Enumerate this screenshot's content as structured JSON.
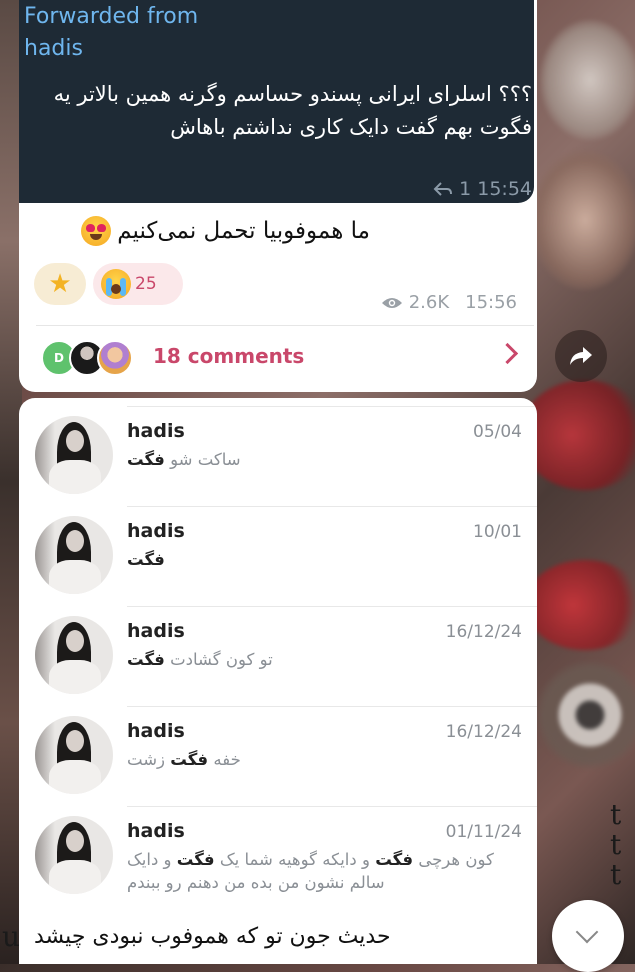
{
  "post": {
    "forwarded_label": "Forwarded from",
    "forwarded_name": "hadis",
    "forwarded_text": "؟؟؟ اسلرای ایرانی پسندو حساسم وگرنه همین بالاتر یه فگوت بهم گفت دایک کاری نداشتم باهاش",
    "forwarded_replies": "1",
    "forwarded_time": "15:54",
    "caption": "ما هموفوبیا تحمل نمی‌کنیم",
    "caption_emoji": "heart-eyes-emoji",
    "reactions": [
      {
        "emoji": "star-emoji",
        "count": ""
      },
      {
        "emoji": "crying-face-emoji",
        "count": "25"
      }
    ],
    "views": "2.6K",
    "time": "15:56",
    "comments_label": "18 comments",
    "commenter_avatar_initial": "D"
  },
  "comments": [
    {
      "name": "hadis",
      "date": "05/04",
      "text_before": "ساکت شو ",
      "highlight": "فگت",
      "text_after": ""
    },
    {
      "name": "hadis",
      "date": "10/01",
      "text_before": "",
      "highlight": "فگت",
      "text_after": ""
    },
    {
      "name": "hadis",
      "date": "16/12/24",
      "text_before": "تو کون گشادت ",
      "highlight": "فگت",
      "text_after": ""
    },
    {
      "name": "hadis",
      "date": "16/12/24",
      "text_before": "خفه ",
      "highlight": "فگت",
      "text_after": " زشت"
    },
    {
      "name": "hadis",
      "date": "01/11/24",
      "text_before": "کون هرچی ",
      "highlight": "فگت",
      "text_after": " و دایکه گوهیه شما یک ",
      "highlight2": "فگت",
      "text_after2": " و دایک سالم نشون من بده من دهنم رو ببندم"
    }
  ],
  "bottom_message": "حدیث جون تو که هموفوب نبودی چیشد",
  "colors": {
    "accent": "#c9476a",
    "link": "#6fb6ee",
    "forward_bg": "#1e2a35"
  }
}
